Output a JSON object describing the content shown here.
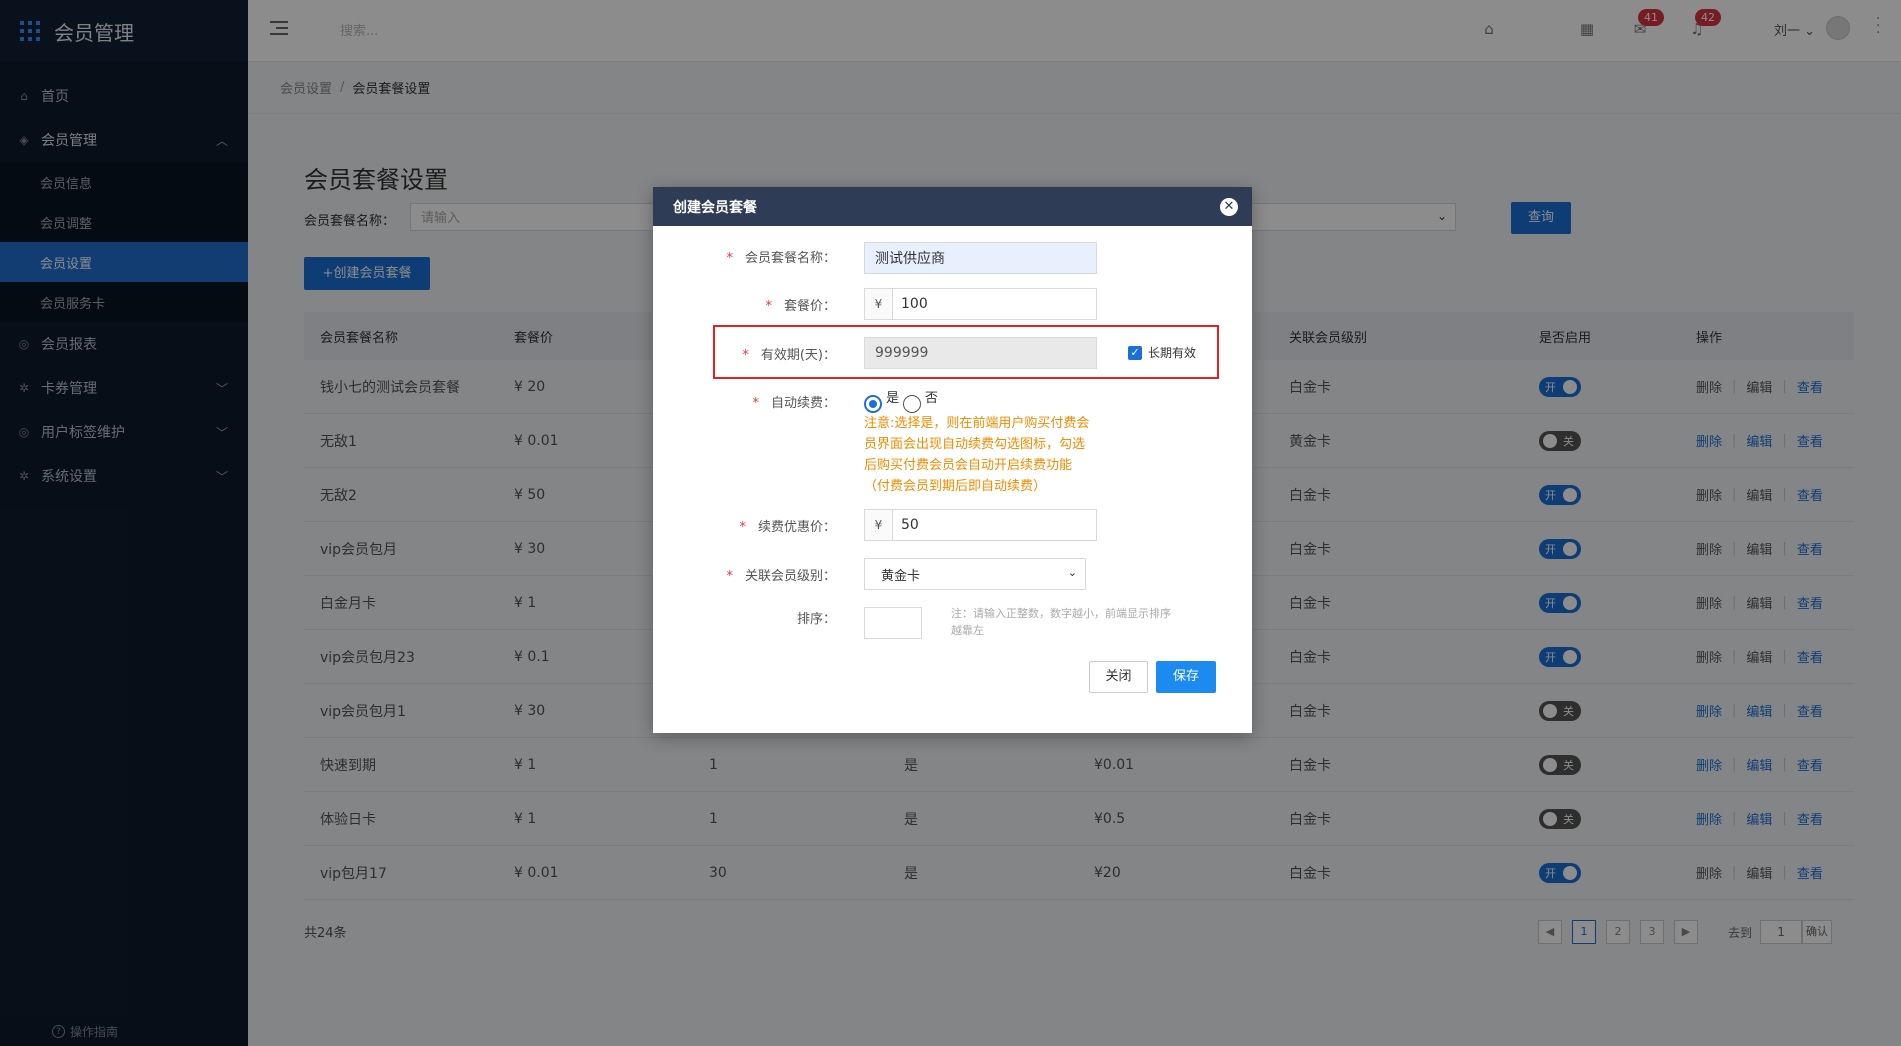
{
  "app": {
    "title": "会员管理"
  },
  "sidebar": {
    "items": [
      {
        "label": "首页",
        "icon": "home-icon"
      },
      {
        "label": "会员管理",
        "icon": "shield-icon",
        "open": true
      },
      {
        "label": "会员信息"
      },
      {
        "label": "会员调整"
      },
      {
        "label": "会员设置",
        "active": true
      },
      {
        "label": "会员服务卡"
      },
      {
        "label": "会员报表",
        "icon": "chart-icon"
      },
      {
        "label": "卡券管理",
        "icon": "gear-icon"
      },
      {
        "label": "用户标签维护",
        "icon": "tag-icon"
      },
      {
        "label": "系统设置",
        "icon": "settings-icon"
      }
    ],
    "guide": "操作指南"
  },
  "header": {
    "search_placeholder": "搜索...",
    "mail_badge": "41",
    "bell_badge": "42",
    "user": "刘一"
  },
  "breadcrumb": {
    "parent": "会员设置",
    "separator": "/",
    "current": "会员套餐设置"
  },
  "page": {
    "title": "会员套餐设置",
    "filter_label": "会员套餐名称：",
    "filter_placeholder": "请输入",
    "query_label": "查询",
    "create_label": "+创建会员套餐"
  },
  "table": {
    "headers": [
      "会员套餐名称",
      "套餐价",
      "",
      "",
      "",
      "关联会员级别",
      "是否启用",
      "操作"
    ],
    "rows": [
      {
        "name": "钱小七的测试会员套餐",
        "price": "¥ 20",
        "days": "",
        "auto": "",
        "renew": "",
        "level": "白金卡",
        "enabled": true
      },
      {
        "name": "无敌1",
        "price": "¥ 0.01",
        "days": "",
        "auto": "",
        "renew": "",
        "level": "黄金卡",
        "enabled": false
      },
      {
        "name": "无敌2",
        "price": "¥ 50",
        "days": "",
        "auto": "",
        "renew": "",
        "level": "白金卡",
        "enabled": true
      },
      {
        "name": "vip会员包月",
        "price": "¥ 30",
        "days": "",
        "auto": "",
        "renew": "",
        "level": "白金卡",
        "enabled": true
      },
      {
        "name": "白金月卡",
        "price": "¥ 1",
        "days": "",
        "auto": "",
        "renew": "",
        "level": "白金卡",
        "enabled": true
      },
      {
        "name": "vip会员包月23",
        "price": "¥ 0.1",
        "days": "",
        "auto": "",
        "renew": "",
        "level": "白金卡",
        "enabled": true
      },
      {
        "name": "vip会员包月1",
        "price": "¥ 30",
        "days": "",
        "auto": "",
        "renew": "",
        "level": "白金卡",
        "enabled": false
      },
      {
        "name": "快速到期",
        "price": "¥ 1",
        "days": "1",
        "auto": "是",
        "renew": "¥0.01",
        "level": "白金卡",
        "enabled": false
      },
      {
        "name": "体验日卡",
        "price": "¥ 1",
        "days": "1",
        "auto": "是",
        "renew": "¥0.5",
        "level": "白金卡",
        "enabled": false
      },
      {
        "name": "vip包月17",
        "price": "¥ 0.01",
        "days": "30",
        "auto": "是",
        "renew": "¥20",
        "level": "白金卡",
        "enabled": true
      }
    ],
    "toggle_on": "开",
    "toggle_off": "关",
    "op_delete": "删除",
    "op_edit": "编辑",
    "op_view": "查看"
  },
  "footer": {
    "total": "共24条",
    "pages": [
      "1",
      "2",
      "3"
    ],
    "goto": "去到",
    "goto_value": "1",
    "confirm": "确认"
  },
  "modal": {
    "title": "创建会员套餐",
    "name_label": "会员套餐名称：",
    "name_value": "测试供应商",
    "price_label": "套餐价：",
    "currency": "¥",
    "price_value": "100",
    "validity_label": "有效期(天)：",
    "validity_value": "999999",
    "long_term_label": "长期有效",
    "auto_renew_label": "自动续费：",
    "yes": "是",
    "no": "否",
    "auto_note": "注意:选择是，则在前端用户购买付费会员界面会出现自动续费勾选图标，勾选后购买付费会员会自动开启续费功能（付费会员到期后即自动续费）",
    "renew_price_label": "续费优惠价：",
    "renew_price_value": "50",
    "level_label": "关联会员级别：",
    "level_value": "黄金卡",
    "sort_label": "排序：",
    "sort_note": "注：请输入正整数，数字越小，前端显示排序越靠左",
    "close_label": "关闭",
    "save_label": "保存"
  },
  "colors": {
    "primary": "#1b6fd8",
    "sidebar_bg": "#0d1b2c",
    "warning": "#f08c00",
    "highlight": "#e62020"
  }
}
